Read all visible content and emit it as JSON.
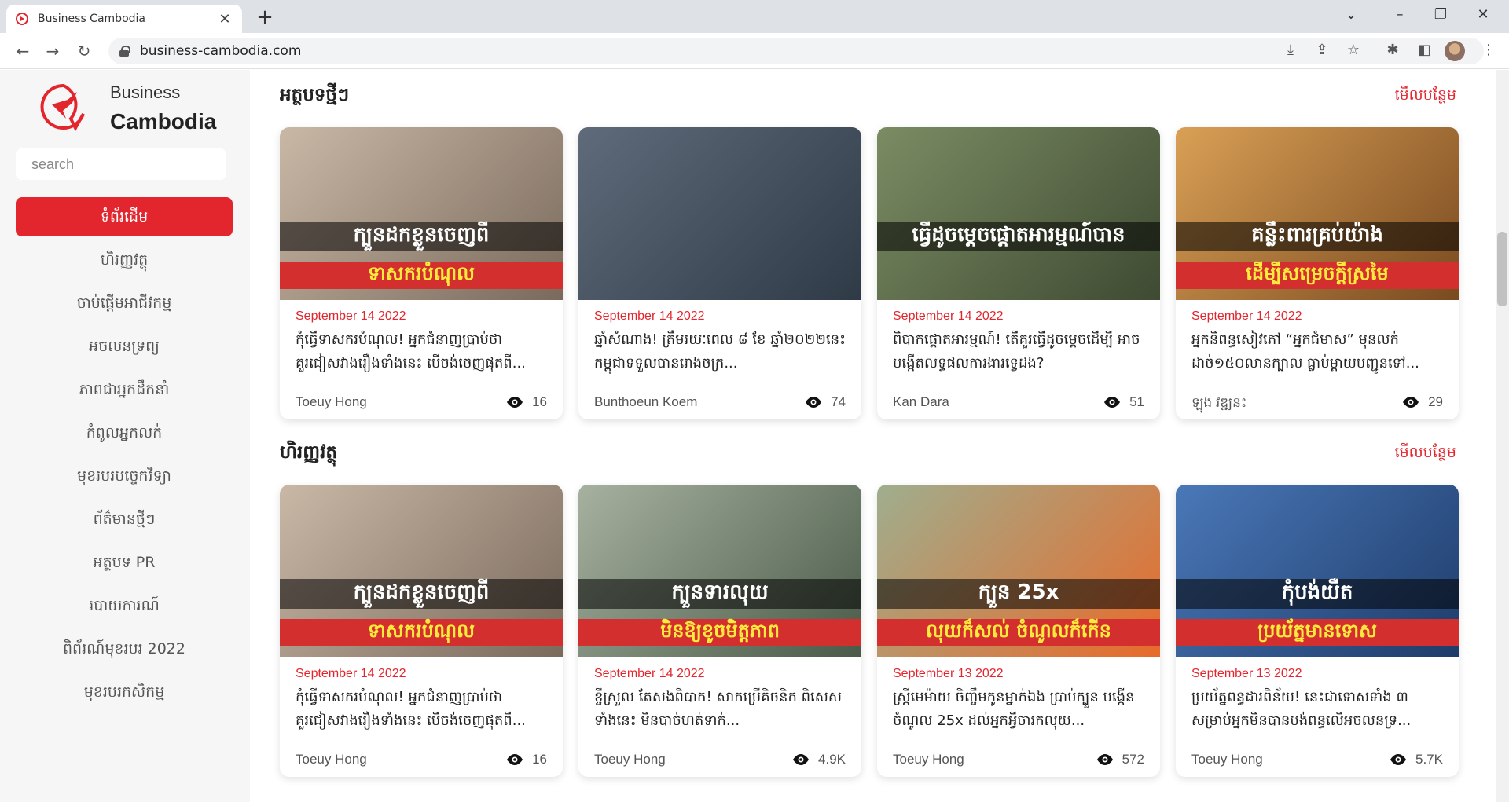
{
  "browser": {
    "tab_title": "Business Cambodia",
    "url": "business-cambodia.com"
  },
  "sidebar": {
    "logo_line1": "Business",
    "logo_line2": "Cambodia",
    "search_placeholder": "search",
    "items": [
      {
        "label": "ទំព័រដើម",
        "active": true
      },
      {
        "label": "ហិរញ្ញវត្ថុ"
      },
      {
        "label": "ចាប់ផ្តើមអាជីវកម្ម"
      },
      {
        "label": "អចលនទ្រព្យ"
      },
      {
        "label": "ភាពជាអ្នកដឹកនាំ"
      },
      {
        "label": "កំពូលអ្នកលក់"
      },
      {
        "label": "មុខរបរបច្ចេកវិទ្យា"
      },
      {
        "label": "ព័ត៌មានថ្មីៗ"
      },
      {
        "label": "អត្ថបទ PR"
      },
      {
        "label": "របាយការណ៍"
      },
      {
        "label": "ពិព័រណ៍មុខរបរ 2022"
      },
      {
        "label": "មុខរបរកសិកម្ម"
      }
    ]
  },
  "sections": [
    {
      "title": "អត្ថបទថ្មីៗ",
      "see_more": "មើលបន្ថែម",
      "cards": [
        {
          "date": "September 14 2022",
          "title": "កុំធ្វើទាសករបំណុល! អ្នកជំនាញប្រាប់ថា គួរជៀសវាងរឿងទាំងនេះ បើចង់ចេញផុតពី...",
          "author": "Toeuy Hong",
          "views": "16",
          "overlay1": "ក្បួនដកខ្លួនចេញពី",
          "overlay2": "ទាសករបំណុល",
          "colors": [
            "#c9b8a6",
            "#7a6a5c"
          ]
        },
        {
          "date": "September 14 2022",
          "title": "ឆ្នាំសំណាង! ត្រឹមរយៈពេល ៨ ខែ ឆ្នាំ២០២២នេះ កម្ពុជាទទួលបានរោងចក្រ...",
          "author": "Bunthoeun Koem",
          "views": "74",
          "overlay1": "",
          "overlay2": "",
          "colors": [
            "#5f6b7a",
            "#2f3a47"
          ]
        },
        {
          "date": "September 14 2022",
          "title": "ពិបាកផ្តោតអារម្មណ៍! តើគួរធ្វើដូចម្តេចដើម្បី អាចបង្កើតលទ្ធផលការងារទ្វេដង?",
          "author": "Kan Dara",
          "views": "51",
          "overlay1": "ធ្វើដូចម្តេចផ្តោតអារម្មណ៍បាន",
          "overlay2": "",
          "colors": [
            "#7b8c63",
            "#3e4a32"
          ]
        },
        {
          "date": "September 14 2022",
          "title": "អ្នកនិពន្ធសៀវភៅ “អ្នកជំមាស” មុនលក់ ដាច់១៥០លានក្បាល ធ្លាប់ម្ដាយបញ្ជូនទៅ...",
          "author": "ឡុង វឌ្ឍនះ",
          "views": "29",
          "overlay1": "គន្លឹះពារគ្រប់យ៉ាង",
          "overlay2": "ដើម្បីសម្រេចក្តីស្រមៃ",
          "colors": [
            "#d9a055",
            "#7a4a20"
          ]
        }
      ]
    },
    {
      "title": "ហិរញ្ញវត្ថុ",
      "see_more": "មើលបន្ថែម",
      "cards": [
        {
          "date": "September 14 2022",
          "title": "កុំធ្វើទាសករបំណុល! អ្នកជំនាញប្រាប់ថា គួរជៀសវាងរឿងទាំងនេះ បើចង់ចេញផុតពី...",
          "author": "Toeuy Hong",
          "views": "16",
          "overlay1": "ក្បួនដកខ្លួនចេញពី",
          "overlay2": "ទាសករបំណុល",
          "colors": [
            "#c9b8a6",
            "#7a6a5c"
          ]
        },
        {
          "date": "September 14 2022",
          "title": "ខ្ចីស្រួល តែសងពិបាក! សាកប្រើគិចនិក ពិសេសទាំងនេះ មិនបាច់ហត់ទាក់...",
          "author": "Toeuy Hong",
          "views": "4.9K",
          "overlay1": "ក្បួនទារលុយ",
          "overlay2": "មិនឱ្យខូចមិត្តភាព",
          "colors": [
            "#a7b1a0",
            "#4a5a48"
          ]
        },
        {
          "date": "September 13 2022",
          "title": "ស្ត្រីមេម៉ាយ ចិញ្ចឹមកូនម្នាក់ឯង ប្រាប់ក្បួន បង្កើនចំណូល 25x ដល់អ្នកអ្វីចារកលុយ...",
          "author": "Toeuy Hong",
          "views": "572",
          "overlay1": "ក្បួន 25x",
          "overlay2": "លុយក៏សល់ ចំណូលក៏កើន",
          "colors": [
            "#9fae8e",
            "#e86a2a"
          ]
        },
        {
          "date": "September 13 2022",
          "title": "ប្រយ័ត្នពន្ធដារពិន័យ! នេះជាទោសទាំង ៣ សម្រាប់អ្នកមិនបានបង់ពន្ធលើអចលនទ្រ...",
          "author": "Toeuy Hong",
          "views": "5.7K",
          "overlay1": "កុំបង់យឺត",
          "overlay2": "ប្រយ័ត្នមានទោស",
          "colors": [
            "#4a78b8",
            "#1e3c6a"
          ]
        }
      ]
    }
  ]
}
